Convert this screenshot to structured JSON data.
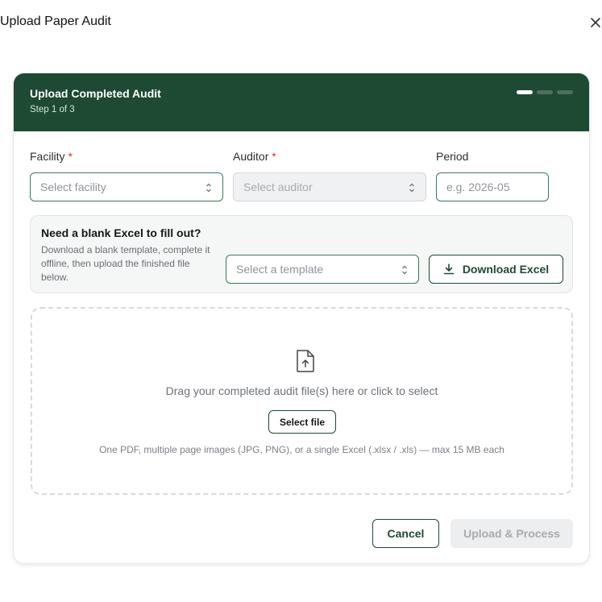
{
  "dialog": {
    "title": "Upload Paper Audit"
  },
  "header": {
    "title": "Upload Completed Audit",
    "step": "Step 1 of 3",
    "total_steps": 3,
    "current_step": 1
  },
  "fields": {
    "facility": {
      "label": "Facility",
      "required_mark": "*",
      "placeholder": "Select facility"
    },
    "auditor": {
      "label": "Auditor",
      "required_mark": "*",
      "placeholder": "Select auditor",
      "disabled": true
    },
    "period": {
      "label": "Period",
      "placeholder": "e.g. 2026-05"
    }
  },
  "template": {
    "title": "Need a blank Excel to fill out?",
    "description": "Download a blank template, complete it offline, then upload the finished file below.",
    "select_placeholder": "Select a template",
    "download_label": "Download Excel"
  },
  "dropzone": {
    "instruction": "Drag your completed audit file(s) here or click to select",
    "button_label": "Select file",
    "note": "One PDF, multiple page images (JPG, PNG), or a single Excel (.xlsx / .xls) — max 15 MB each"
  },
  "footer": {
    "cancel_label": "Cancel",
    "submit_label": "Upload & Process"
  },
  "colors": {
    "brand": "#1e4a33",
    "required": "#d9362b"
  }
}
